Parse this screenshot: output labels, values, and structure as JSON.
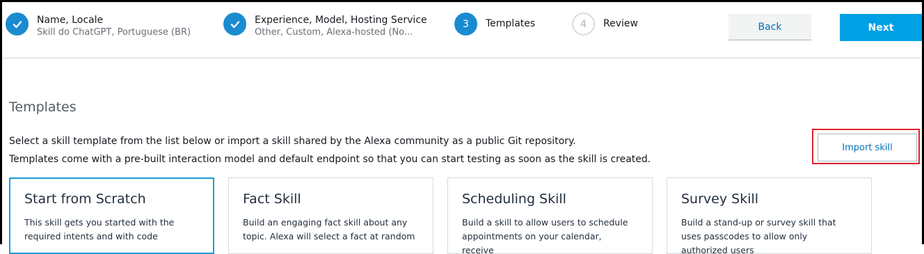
{
  "wizard": {
    "steps": [
      {
        "label": "Name, Locale",
        "sub": "Skill do ChatGPT, Portuguese (BR)",
        "status": "done"
      },
      {
        "label": "Experience, Model, Hosting Service",
        "sub": "Other, Custom, Alexa-hosted (No...",
        "status": "done"
      },
      {
        "label": "Templates",
        "number": "3",
        "status": "active"
      },
      {
        "label": "Review",
        "number": "4",
        "status": "todo"
      }
    ],
    "back_label": "Back",
    "next_label": "Next"
  },
  "main": {
    "title": "Templates",
    "description_1": "Select a skill template from the list below or import a skill shared by the Alexa community as a public Git repository.",
    "description_2": "Templates come with a pre-built interaction model and default endpoint so that you can start testing as soon as the skill is created.",
    "import_label": "Import skill",
    "cards": [
      {
        "title": "Start from Scratch",
        "desc": "This skill gets you started with the required intents and with code",
        "selected": true
      },
      {
        "title": "Fact Skill",
        "desc": "Build an engaging fact skill about any topic. Alexa will select a fact at random"
      },
      {
        "title": "Scheduling Skill",
        "desc": "Build a skill to allow users to schedule appointments on your calendar, receive"
      },
      {
        "title": "Survey Skill",
        "desc": "Build a stand-up or survey skill that uses passcodes to allow only authorized users"
      }
    ]
  },
  "colors": {
    "accent": "#1a8bd0",
    "next_button": "#00a1e4",
    "highlight_outline": "#e0232a"
  }
}
